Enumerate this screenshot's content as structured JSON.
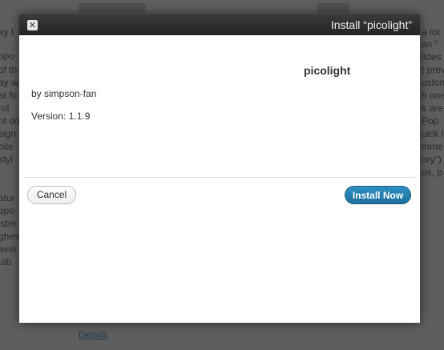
{
  "modal": {
    "title": "Install “picolight”",
    "close_glyph": "✕",
    "plugin_name": "picolight",
    "author_line": "by simpson-fan",
    "version_line": "Version: 1.1.9",
    "cancel_label": "Cancel",
    "install_label": "Install Now"
  },
  "background": {
    "left_fragments": [
      "ay t",
      "ppo",
      "of th",
      "ay w",
      "at fo",
      "rol",
      "nt do",
      "sign",
      "bile",
      "styl",
      "",
      "atur",
      "ppo",
      "ister",
      "ghes",
      "aver",
      "lab"
    ],
    "right_fragments": [
      "a lot",
      "an \"",
      "lides",
      "t prev",
      "ustom",
      "h one",
      "s are",
      "Pop",
      "uick l",
      "mme",
      "ory\")",
      "us, p"
    ],
    "details_link": "Details"
  },
  "colors": {
    "install_button": "#2585b8",
    "titlebar": "#2b2b2b"
  }
}
